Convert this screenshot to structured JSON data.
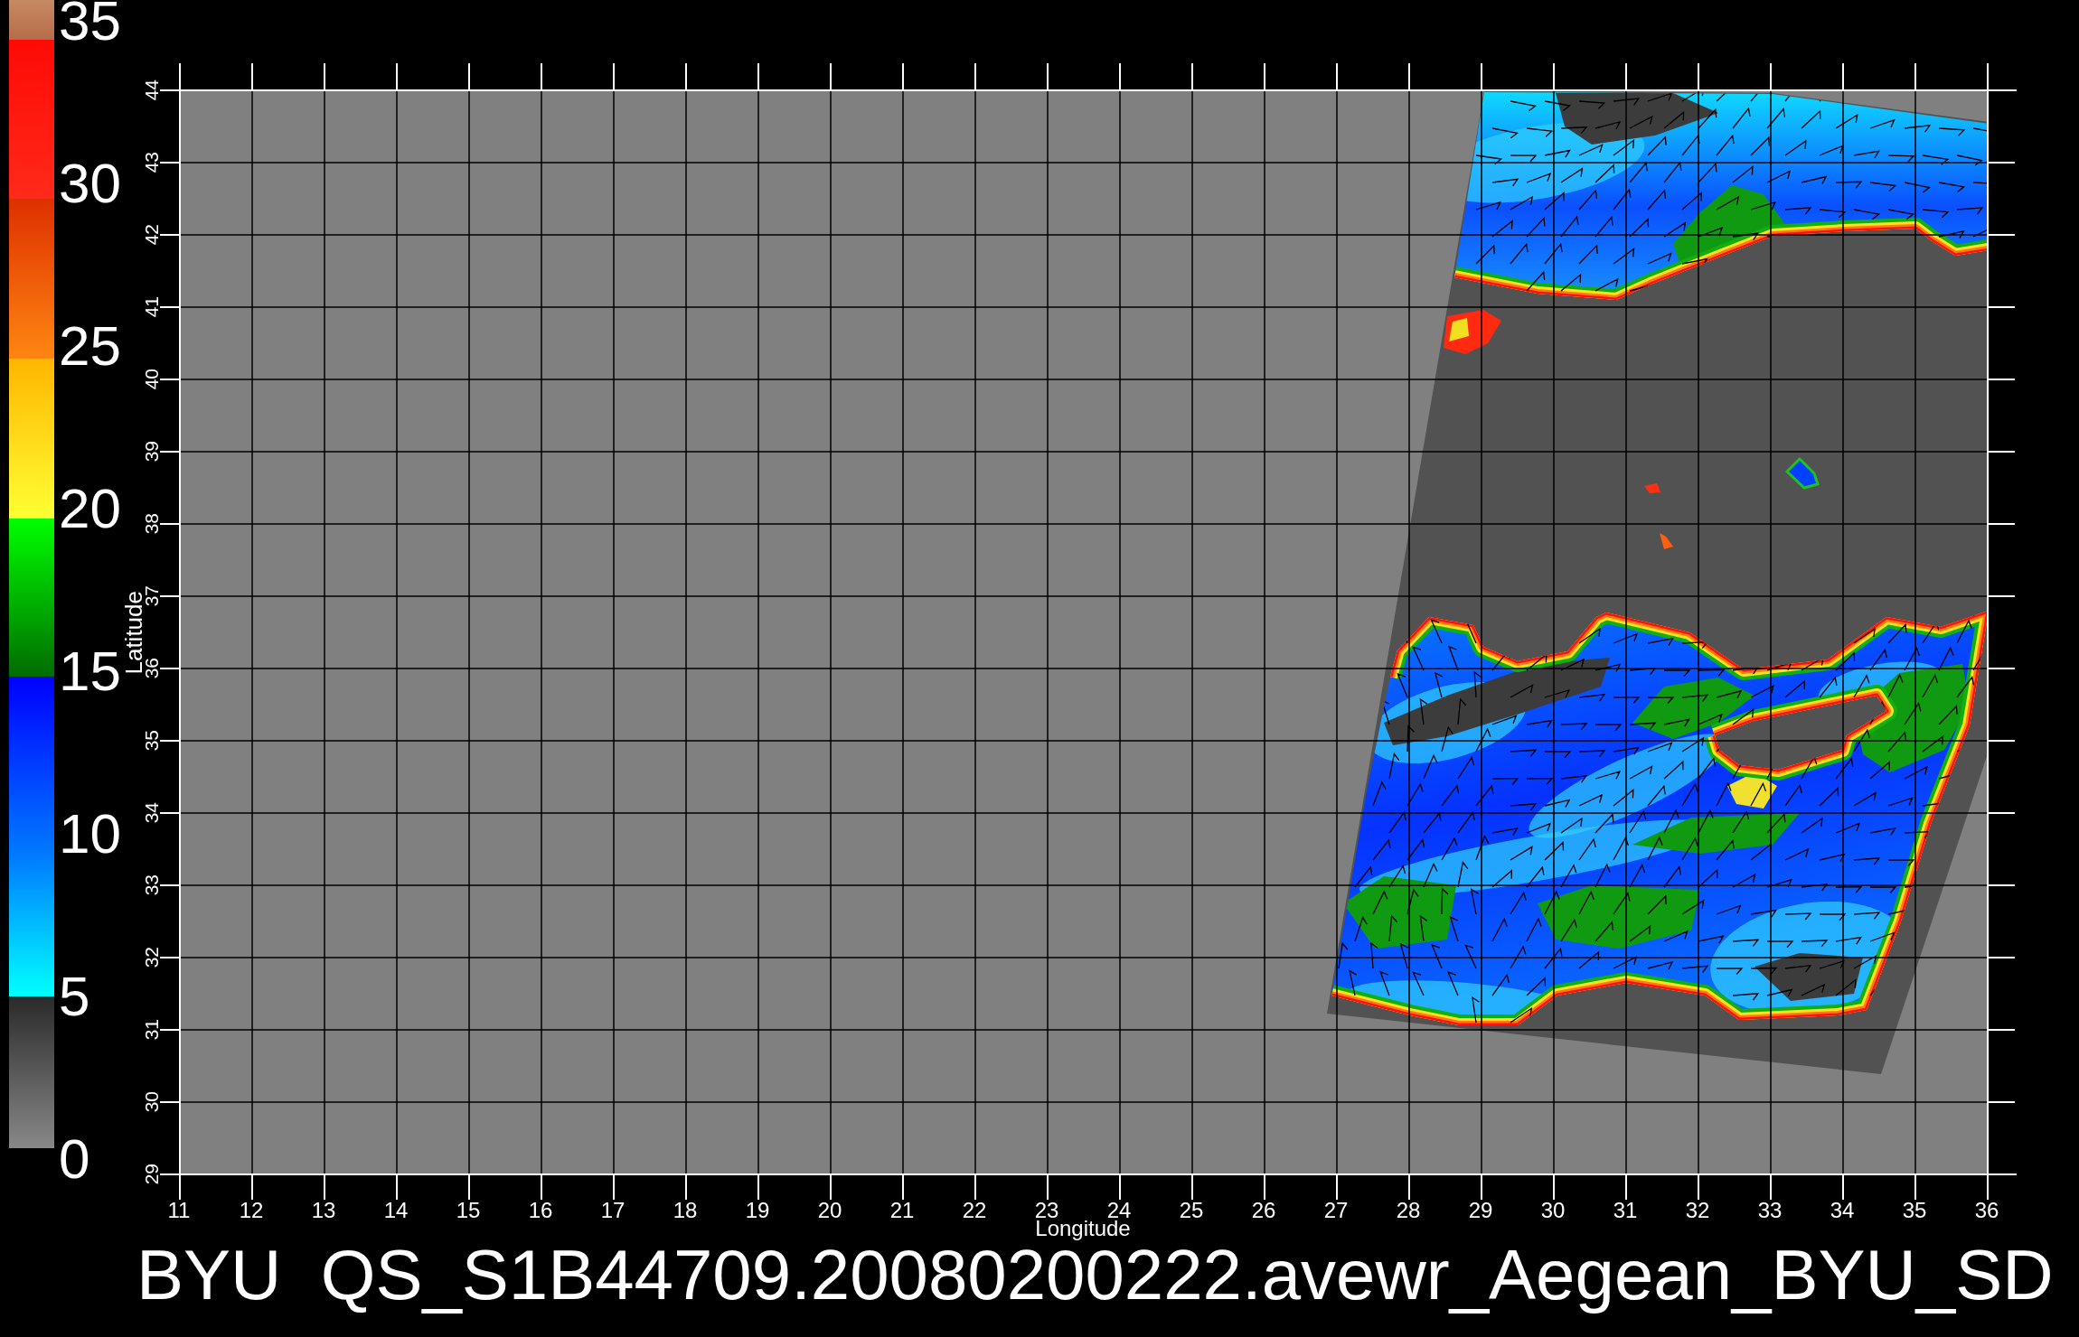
{
  "colorbar": {
    "labels": [
      "35",
      "30",
      "25",
      "20",
      "15",
      "10",
      "5",
      "0"
    ]
  },
  "y_axis": {
    "title": "Latitude",
    "ticks": [
      "44",
      "43",
      "42",
      "41",
      "40",
      "39",
      "38",
      "37",
      "36",
      "35",
      "34",
      "33",
      "32",
      "31",
      "30",
      "29"
    ]
  },
  "x_axis": {
    "title": "Longitude",
    "ticks": [
      "11",
      "12",
      "13",
      "14",
      "15",
      "16",
      "17",
      "18",
      "19",
      "20",
      "21",
      "22",
      "23",
      "24",
      "25",
      "26",
      "27",
      "28",
      "29",
      "30",
      "31",
      "32",
      "33",
      "34",
      "35",
      "36"
    ]
  },
  "title": "BYU  QS_S1B44709.20080200222.avewr_Aegean_BYU_SD"
}
